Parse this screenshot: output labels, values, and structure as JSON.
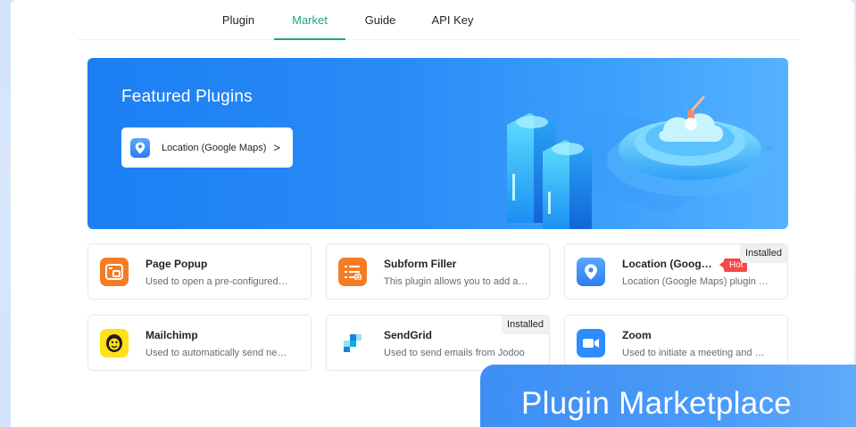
{
  "nav": {
    "tabs": [
      {
        "label": "Plugin"
      },
      {
        "label": "Market"
      },
      {
        "label": "Guide"
      },
      {
        "label": "API Key"
      }
    ],
    "active_tab": "Market"
  },
  "banner": {
    "title": "Featured Plugins",
    "featured_item": {
      "label": "Location (Google Maps)",
      "chevron": ">",
      "icon": "map-pin-icon"
    }
  },
  "plugins": [
    {
      "name": "Page Popup",
      "description": "Used to open a pre-configured…",
      "icon": "popup-window-icon",
      "color": "#f57c23"
    },
    {
      "name": "Subform Filler",
      "description": "This plugin allows you to add a…",
      "icon": "list-add-icon",
      "color": "#f57c23"
    },
    {
      "name": "Location (Goog…",
      "description": "Location (Google Maps) plugin …",
      "icon": "map-pin-icon",
      "color": "#3b8cf5",
      "hot_badge": "Hot",
      "installed_badge": "Installed"
    },
    {
      "name": "Mailchimp",
      "description": "Used to automatically send ne…",
      "icon": "mailchimp-icon",
      "color": "#ffe01b"
    },
    {
      "name": "SendGrid",
      "description": "Used to send emails from Jodoo",
      "icon": "sendgrid-icon",
      "color": "#1a82e2",
      "installed_badge": "Installed"
    },
    {
      "name": "Zoom",
      "description": "Used to initiate a meeting and …",
      "icon": "video-camera-icon",
      "color": "#2d8cff"
    }
  ],
  "overlay": {
    "label": "Plugin Marketplace"
  },
  "colors": {
    "accent": "#17a789",
    "banner_blue": "#1b7ff3",
    "hot": "#f54a45"
  }
}
